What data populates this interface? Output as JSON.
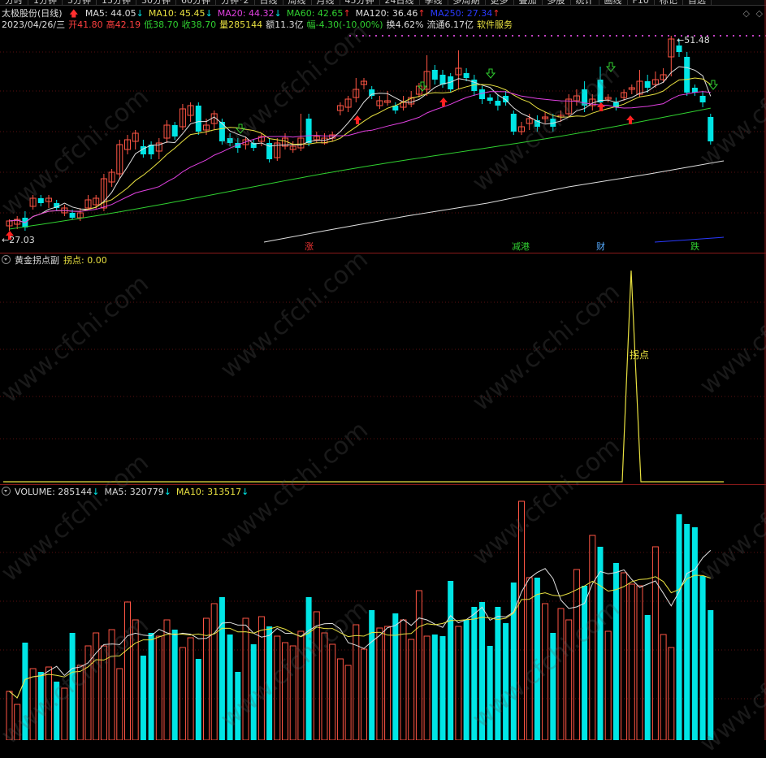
{
  "toolbar": {
    "items": [
      "分时",
      "1分钟",
      "5分钟",
      "15分钟",
      "30分钟",
      "60分钟",
      "分钟*2",
      "日线",
      "周线",
      "月线",
      "45分钟",
      "24日线",
      "季线",
      "多周期",
      "更多"
    ],
    "right_items": [
      "叠加",
      "多股",
      "统计",
      "画线",
      "F10",
      "标记",
      "自选"
    ]
  },
  "header": {
    "stock": "太极股份(日线)",
    "ma": [
      {
        "label": "MA5: 44.05",
        "color": "#dddddd",
        "arrow": "↓"
      },
      {
        "label": "MA10: 45.45",
        "color": "#e8e040",
        "arrow": "↓"
      },
      {
        "label": "MA20: 44.32",
        "color": "#e040e0",
        "arrow": "↓"
      },
      {
        "label": "MA60: 42.65",
        "color": "#30d030",
        "arrow": "↑"
      },
      {
        "label": "MA120: 36.46",
        "color": "#dddddd",
        "arrow": "↑"
      },
      {
        "label": "MA250: 27.34",
        "color": "#2a3aff",
        "arrow": "↑"
      }
    ],
    "info": [
      {
        "text": "2023/04/26/三",
        "color": "#dddddd"
      },
      {
        "text": "开41.80",
        "color": "#ff4040"
      },
      {
        "text": "高42.19",
        "color": "#ff4040"
      },
      {
        "text": "低38.70",
        "color": "#30d030"
      },
      {
        "text": "收38.70",
        "color": "#30d030"
      },
      {
        "text": "量285144",
        "color": "#e8e040"
      },
      {
        "text": "额11.3亿",
        "color": "#dddddd"
      },
      {
        "text": "幅-4.30(-10.00%)",
        "color": "#30d030"
      },
      {
        "text": "换4.62%",
        "color": "#dddddd"
      },
      {
        "text": "流通6.17亿",
        "color": "#dddddd"
      },
      {
        "text": "软件服务",
        "color": "#e8e040"
      }
    ],
    "high_label": "51.48",
    "low_label": "27.03"
  },
  "news_tags": [
    {
      "text": "涨",
      "color": "#ff4040"
    },
    {
      "text": "减港",
      "color": "#30d030"
    },
    {
      "text": "财",
      "color": "#55aaff"
    },
    {
      "text": "跌",
      "color": "#30d030"
    }
  ],
  "indicator": {
    "title": "黄金拐点副",
    "value_label": "拐点: 0.00",
    "peak_label": "拐点"
  },
  "volume": {
    "title": "VOLUME: 285144",
    "ma5": "MA5: 320779",
    "ma10": "MA10: 313517",
    "title_color": "#dddddd",
    "ma5_color": "#dddddd",
    "ma10_color": "#e8e040"
  },
  "watermark": "www.cfchi.com",
  "colors": {
    "up": "#ff5544",
    "down": "#00e5e5",
    "ma5": "#e0e0e0",
    "ma10": "#e8e040",
    "ma20": "#e040e0",
    "ma60": "#30d030",
    "ma120": "#e0e0e0",
    "ma250": "#2a3aff"
  }
}
